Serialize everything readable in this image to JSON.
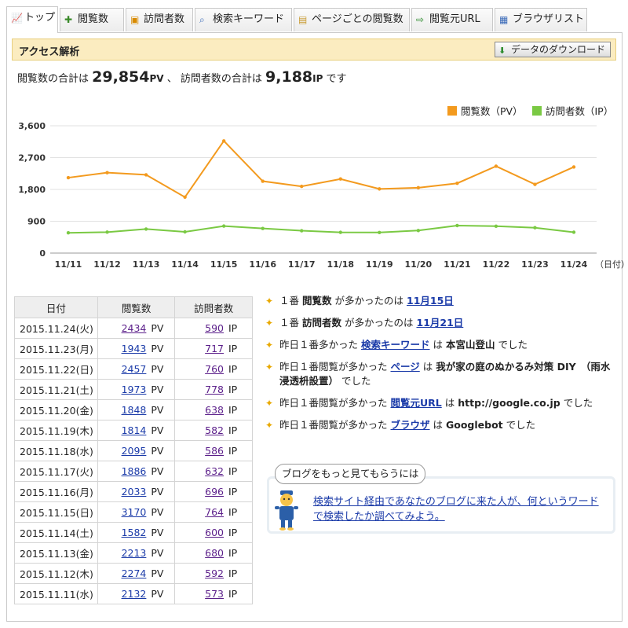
{
  "tabs": [
    {
      "label": "トップ",
      "icon": "line-chart-icon",
      "active": true
    },
    {
      "label": "閲覧数",
      "icon": "views-icon"
    },
    {
      "label": "訪問者数",
      "icon": "visitors-icon"
    },
    {
      "label": "検索キーワード",
      "icon": "search-keyword-icon"
    },
    {
      "label": "ページごとの閲覧数",
      "icon": "page-icon"
    },
    {
      "label": "閲覧元URL",
      "icon": "referrer-icon"
    },
    {
      "label": "ブラウザリスト",
      "icon": "browser-icon"
    }
  ],
  "header": {
    "title": "アクセス解析",
    "download_label": "データのダウンロード"
  },
  "summary": {
    "pv_prefix": "閲覧数の合計は",
    "pv_total": "29,854",
    "pv_unit": "PV",
    "sep": "、",
    "ip_prefix": "訪問者数の合計は",
    "ip_total": "9,188",
    "ip_unit": "IP",
    "suffix": "です"
  },
  "chart_data": {
    "type": "line",
    "x": [
      "11/11",
      "11/12",
      "11/13",
      "11/14",
      "11/15",
      "11/16",
      "11/17",
      "11/18",
      "11/19",
      "11/20",
      "11/21",
      "11/22",
      "11/23",
      "11/24"
    ],
    "xlabel": "（日付）",
    "yticks": [
      "0",
      "900",
      "1,800",
      "2,700",
      "3,600"
    ],
    "ylim": [
      0,
      3600
    ],
    "grid": true,
    "legend_position": "top-right",
    "series": [
      {
        "name": "閲覧数（PV）",
        "color": "#f39a1e",
        "values": [
          2132,
          2274,
          2213,
          1582,
          3170,
          2033,
          1886,
          2095,
          1814,
          1848,
          1973,
          2457,
          1943,
          2434
        ]
      },
      {
        "name": "訪問者数（IP）",
        "color": "#7ac943",
        "values": [
          573,
          592,
          680,
          600,
          764,
          696,
          632,
          586,
          582,
          638,
          778,
          760,
          717,
          590
        ]
      }
    ]
  },
  "table": {
    "headers": [
      "日付",
      "閲覧数",
      "訪問者数"
    ],
    "pv_unit": "PV",
    "ip_unit": "IP",
    "rows": [
      {
        "date": "2015.11.24(火)",
        "pv": "2434",
        "ip": "590"
      },
      {
        "date": "2015.11.23(月)",
        "pv": "1943",
        "ip": "717"
      },
      {
        "date": "2015.11.22(日)",
        "pv": "2457",
        "ip": "760"
      },
      {
        "date": "2015.11.21(土)",
        "pv": "1973",
        "ip": "778"
      },
      {
        "date": "2015.11.20(金)",
        "pv": "1848",
        "ip": "638"
      },
      {
        "date": "2015.11.19(木)",
        "pv": "1814",
        "ip": "582"
      },
      {
        "date": "2015.11.18(水)",
        "pv": "2095",
        "ip": "586"
      },
      {
        "date": "2015.11.17(火)",
        "pv": "1886",
        "ip": "632"
      },
      {
        "date": "2015.11.16(月)",
        "pv": "2033",
        "ip": "696"
      },
      {
        "date": "2015.11.15(日)",
        "pv": "3170",
        "ip": "764"
      },
      {
        "date": "2015.11.14(土)",
        "pv": "1582",
        "ip": "600"
      },
      {
        "date": "2015.11.13(金)",
        "pv": "2213",
        "ip": "680"
      },
      {
        "date": "2015.11.12(木)",
        "pv": "2274",
        "ip": "592"
      },
      {
        "date": "2015.11.11(水)",
        "pv": "2132",
        "ip": "573"
      }
    ]
  },
  "notes": [
    {
      "t1": "１番",
      "b1": "閲覧数",
      "t2": "が多かったのは",
      "link": "11月15日"
    },
    {
      "t1": "１番",
      "b1": "訪問者数",
      "t2": "が多かったのは",
      "link": "11月21日"
    },
    {
      "t1": "昨日１番多かった",
      "link": "検索キーワード",
      "t2": "は",
      "b2": "本宮山登山",
      "t3": "でした"
    },
    {
      "t1": "昨日１番閲覧が多かった",
      "link": "ページ",
      "t2": "は",
      "b2": "我が家の庭のぬかるみ対策 DIY　（雨水浸透枡設置）",
      "t3": "でした"
    },
    {
      "t1": "昨日１番閲覧が多かった",
      "link": "閲覧元URL",
      "t2": "は",
      "b2": "http://google.co.jp",
      "t3": "でした"
    },
    {
      "t1": "昨日１番閲覧が多かった",
      "link": "ブラウザ",
      "t2": "は",
      "b2": "Googlebot",
      "t3": "でした"
    }
  ],
  "tip": {
    "bubble": "ブログをもっと見てもらうには",
    "link": "検索サイト経由であなたのブログに来た人が、何というワードで検索したか調べてみよう。"
  }
}
